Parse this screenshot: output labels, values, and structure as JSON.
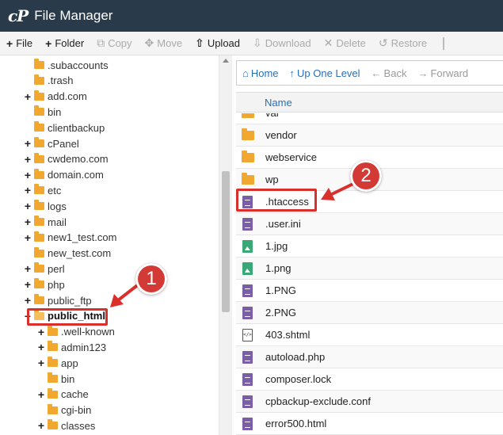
{
  "app": {
    "logo": "cP",
    "title": "File Manager"
  },
  "toolbar": {
    "buttons": [
      {
        "label": "File",
        "icon": "+",
        "icon_name": "plus-icon",
        "enabled": true
      },
      {
        "label": "Folder",
        "icon": "+",
        "icon_name": "plus-icon",
        "enabled": true
      },
      {
        "label": "Copy",
        "icon": "⧉",
        "icon_name": "copy-icon",
        "enabled": false
      },
      {
        "label": "Move",
        "icon": "✥",
        "icon_name": "move-icon",
        "enabled": false
      },
      {
        "label": "Upload",
        "icon": "⇧",
        "icon_name": "upload-icon",
        "enabled": true
      },
      {
        "label": "Download",
        "icon": "⇩",
        "icon_name": "download-icon",
        "enabled": false
      },
      {
        "label": "Delete",
        "icon": "✕",
        "icon_name": "delete-icon",
        "enabled": false
      },
      {
        "label": "Restore",
        "icon": "↺",
        "icon_name": "restore-icon",
        "enabled": false
      }
    ]
  },
  "tree": {
    "items": [
      {
        "label": ".subaccounts",
        "toggle": ""
      },
      {
        "label": ".trash",
        "toggle": ""
      },
      {
        "label": "add.com",
        "toggle": "+"
      },
      {
        "label": "bin",
        "toggle": ""
      },
      {
        "label": "clientbackup",
        "toggle": ""
      },
      {
        "label": "cPanel",
        "toggle": "+"
      },
      {
        "label": "cwdemo.com",
        "toggle": "+"
      },
      {
        "label": "domain.com",
        "toggle": "+"
      },
      {
        "label": "etc",
        "toggle": "+"
      },
      {
        "label": "logs",
        "toggle": "+"
      },
      {
        "label": "mail",
        "toggle": "+"
      },
      {
        "label": "new1_test.com",
        "toggle": "+"
      },
      {
        "label": "new_test.com",
        "toggle": ""
      },
      {
        "label": "perl",
        "toggle": "+"
      },
      {
        "label": "php",
        "toggle": "+"
      },
      {
        "label": "public_ftp",
        "toggle": "+"
      },
      {
        "label": "public_html",
        "toggle": "−",
        "open": true,
        "selected": true
      },
      {
        "label": ".well-known",
        "toggle": "+",
        "child": true
      },
      {
        "label": "admin123",
        "toggle": "+",
        "child": true
      },
      {
        "label": "app",
        "toggle": "+",
        "child": true
      },
      {
        "label": "bin",
        "toggle": "",
        "child": true
      },
      {
        "label": "cache",
        "toggle": "+",
        "child": true
      },
      {
        "label": "cgi-bin",
        "toggle": "",
        "child": true
      },
      {
        "label": "classes",
        "toggle": "+",
        "child": true
      }
    ]
  },
  "nav": {
    "buttons": [
      {
        "label": "Home",
        "icon": "⌂",
        "icon_name": "home-icon",
        "enabled": true
      },
      {
        "label": "Up One Level",
        "icon": "↑",
        "icon_name": "up-level-icon",
        "enabled": true
      },
      {
        "label": "Back",
        "icon": "←",
        "icon_name": "back-icon",
        "enabled": false
      },
      {
        "label": "Forward",
        "icon": "→",
        "icon_name": "forward-icon",
        "enabled": false
      }
    ]
  },
  "file_list": {
    "column_name": "Name",
    "files": [
      {
        "name": "var",
        "type": "folder"
      },
      {
        "name": "vendor",
        "type": "folder"
      },
      {
        "name": "webservice",
        "type": "folder"
      },
      {
        "name": "wp",
        "type": "folder"
      },
      {
        "name": ".htaccess",
        "type": "doc"
      },
      {
        "name": ".user.ini",
        "type": "doc"
      },
      {
        "name": "1.jpg",
        "type": "image"
      },
      {
        "name": "1.png",
        "type": "image"
      },
      {
        "name": "1.PNG",
        "type": "doc"
      },
      {
        "name": "2.PNG",
        "type": "doc"
      },
      {
        "name": "403.shtml",
        "type": "code"
      },
      {
        "name": "autoload.php",
        "type": "doc"
      },
      {
        "name": "composer.lock",
        "type": "doc"
      },
      {
        "name": "cpbackup-exclude.conf",
        "type": "doc"
      },
      {
        "name": "error500.html",
        "type": "doc"
      }
    ]
  },
  "annotations": {
    "step1": "1",
    "step2": "2",
    "color": "#d9302c"
  }
}
